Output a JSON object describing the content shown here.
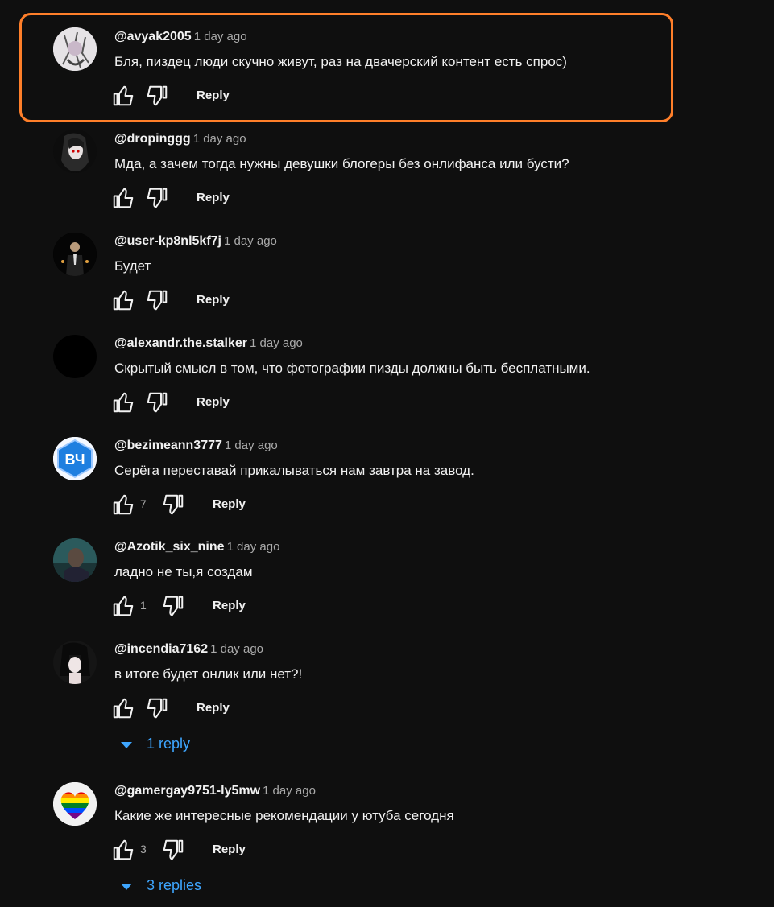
{
  "highlight_color": "#ff7f2a",
  "reply_label": "Reply",
  "comments": [
    {
      "author": "@avyak2005",
      "time": "1 day ago",
      "text": "Бля, пиздец люди скучно живут, раз на двачерский контент есть спрос)",
      "likes": "",
      "replies": "",
      "avatar": "avatar-anime-sketch"
    },
    {
      "author": "@dropinggg",
      "time": "1 day ago",
      "text": "Мда, а зачем тогда нужны девушки блогеры без онлифанса или бусти?",
      "likes": "",
      "replies": "",
      "avatar": "avatar-dark-anime-girl"
    },
    {
      "author": "@user-kp8nl5kf7j",
      "time": "1 day ago",
      "text": "Будет",
      "likes": "",
      "replies": "",
      "avatar": "avatar-man-in-suit"
    },
    {
      "author": "@alexandr.the.stalker",
      "time": "1 day ago",
      "text": "Скрытый смысл в том, что фотографии пизды должны быть бесплатными.",
      "likes": "",
      "replies": "",
      "avatar": "avatar-black"
    },
    {
      "author": "@bezimeann3777",
      "time": "1 day ago",
      "text": "Серёга переставай прикалываться нам завтра на завод.",
      "likes": "7",
      "replies": "",
      "avatar": "avatar-blue-logo"
    },
    {
      "author": "@Azotik_six_nine",
      "time": "1 day ago",
      "text": "ладно не ты,я создам",
      "likes": "1",
      "replies": "",
      "avatar": "avatar-teal-photo"
    },
    {
      "author": "@incendia7162",
      "time": "1 day ago",
      "text": "в итоге будет онлик или нет?!",
      "likes": "",
      "replies": "1 reply",
      "avatar": "avatar-dark-hair-girl"
    },
    {
      "author": "@gamergay9751-ly5mw",
      "time": "1 day ago",
      "text": "Какие же интересные рекомендации у ютуба сегодня",
      "likes": "3",
      "replies": "3 replies",
      "avatar": "avatar-rainbow-heart"
    }
  ]
}
